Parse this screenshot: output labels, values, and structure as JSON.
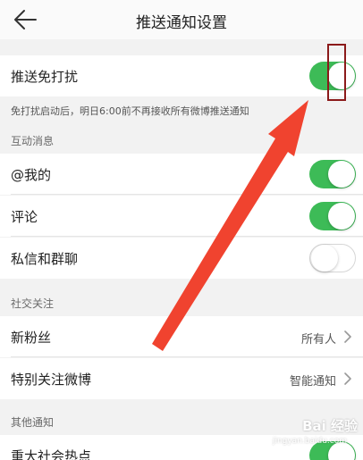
{
  "header": {
    "title": "推送通知设置",
    "back_icon": "back-arrow-icon"
  },
  "dnd": {
    "label": "推送免打扰",
    "toggle_on": true,
    "note": "免打扰启动后，明日6:00前不再接收所有微博推送通知"
  },
  "interaction": {
    "section_title": "互动消息",
    "items": [
      {
        "label": "@我的",
        "toggle_on": true
      },
      {
        "label": "评论",
        "toggle_on": true
      },
      {
        "label": "私信和群聊",
        "toggle_on": false
      }
    ]
  },
  "social": {
    "section_title": "社交关注",
    "items": [
      {
        "label": "新粉丝",
        "value": "所有人"
      },
      {
        "label": "特别关注微博",
        "value": "智能通知"
      }
    ]
  },
  "other": {
    "section_title": "其他通知",
    "items": [
      {
        "label": "重大社会热点",
        "toggle_on": true
      }
    ]
  },
  "watermark": {
    "brand": "Bai 经验",
    "url": "jingyan.baidu.com"
  },
  "colors": {
    "toggle_on": "#3dbb57",
    "annotation_arrow": "#f0432f",
    "annotation_box": "#8b1a1a"
  }
}
